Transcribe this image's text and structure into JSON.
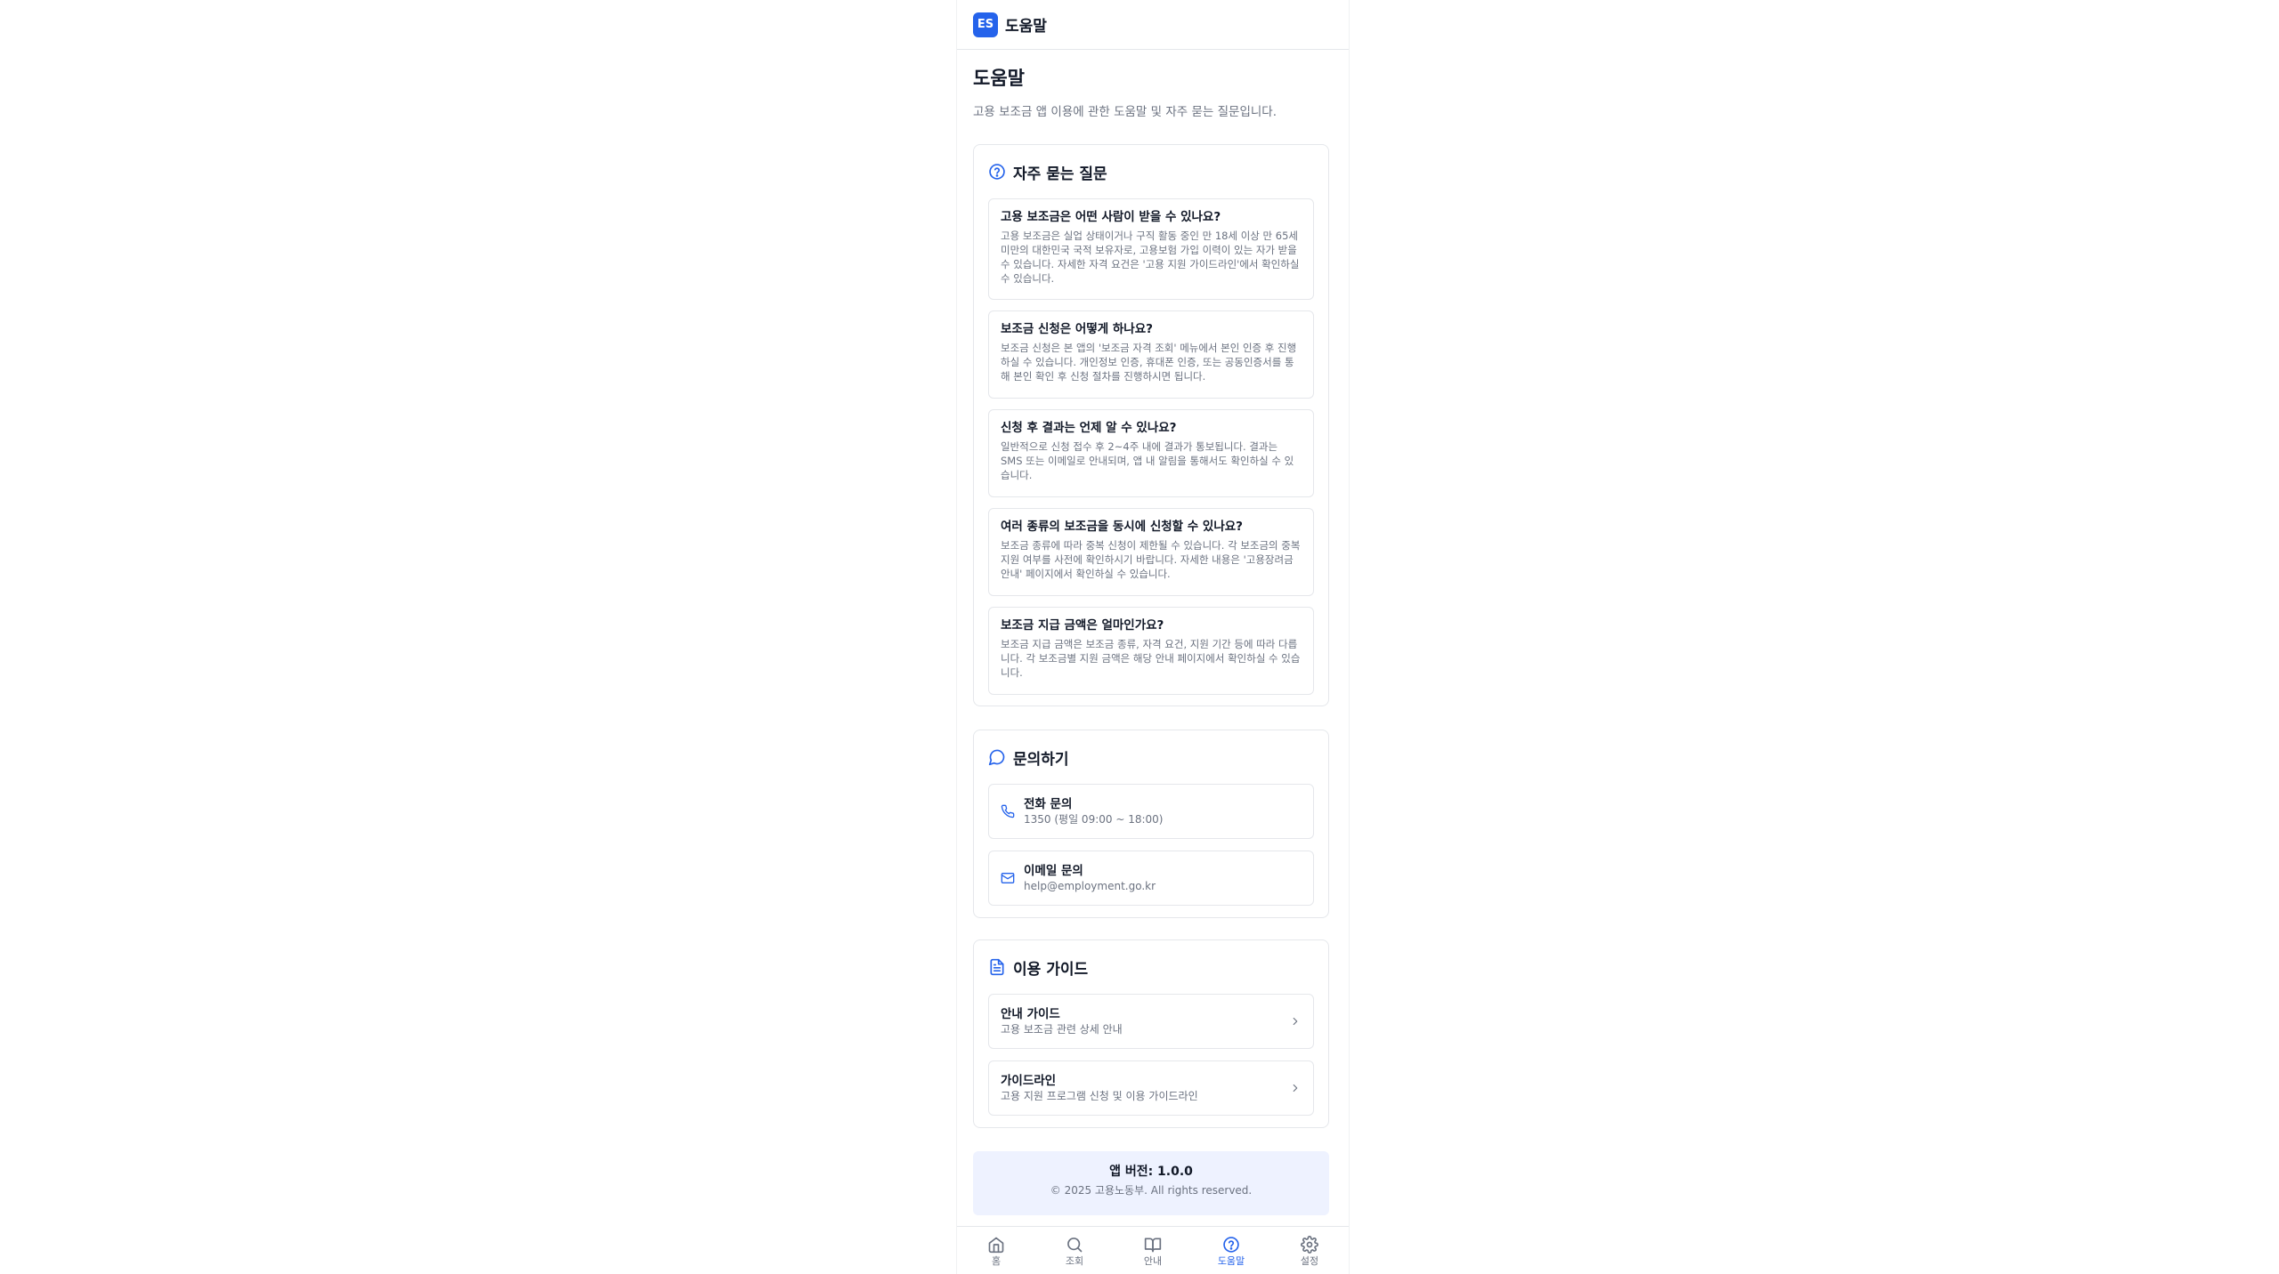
{
  "header": {
    "logo_text": "ES",
    "title": "도움말"
  },
  "page": {
    "title": "도움말",
    "description": "고용 보조금 앱 이용에 관한 도움말 및 자주 묻는 질문입니다."
  },
  "faq": {
    "title": "자주 묻는 질문",
    "icon": "question-circle-icon",
    "items": [
      {
        "q": "고용 보조금은 어떤 사람이 받을 수 있나요?",
        "a": "고용 보조금은 실업 상태이거나 구직 활동 중인 만 18세 이상 만 65세 미만의 대한민국 국적 보유자로, 고용보험 가입 이력이 있는 자가 받을 수 있습니다. 자세한 자격 요건은 '고용 지원 가이드라인'에서 확인하실 수 있습니다."
      },
      {
        "q": "보조금 신청은 어떻게 하나요?",
        "a": "보조금 신청은 본 앱의 '보조금 자격 조회' 메뉴에서 본인 인증 후 진행하실 수 있습니다. 개인정보 인증, 휴대폰 인증, 또는 공동인증서를 통해 본인 확인 후 신청 절차를 진행하시면 됩니다."
      },
      {
        "q": "신청 후 결과는 언제 알 수 있나요?",
        "a": "일반적으로 신청 접수 후 2~4주 내에 결과가 통보됩니다. 결과는 SMS 또는 이메일로 안내되며, 앱 내 알림을 통해서도 확인하실 수 있습니다."
      },
      {
        "q": "여러 종류의 보조금을 동시에 신청할 수 있나요?",
        "a": "보조금 종류에 따라 중복 신청이 제한될 수 있습니다. 각 보조금의 중복 지원 여부를 사전에 확인하시기 바랍니다. 자세한 내용은 '고용장려금 안내' 페이지에서 확인하실 수 있습니다."
      },
      {
        "q": "보조금 지급 금액은 얼마인가요?",
        "a": "보조금 지급 금액은 보조금 종류, 자격 요건, 지원 기간 등에 따라 다릅니다. 각 보조금별 지원 금액은 해당 안내 페이지에서 확인하실 수 있습니다."
      }
    ]
  },
  "contact": {
    "title": "문의하기",
    "icon": "chat-bubble-icon",
    "items": [
      {
        "title": "전화 문의",
        "sub": "1350 (평일 09:00 ~ 18:00)",
        "icon": "phone-icon"
      },
      {
        "title": "이메일 문의",
        "sub": "help@employment.go.kr",
        "icon": "mail-icon"
      }
    ]
  },
  "guide": {
    "title": "이용 가이드",
    "icon": "document-icon",
    "items": [
      {
        "title": "안내 가이드",
        "sub": "고용 보조금 관련 상세 안내",
        "icon": "chevron-right-icon"
      },
      {
        "title": "가이드라인",
        "sub": "고용 지원 프로그램 신청 및 이용 가이드라인",
        "icon": "chevron-right-icon"
      }
    ]
  },
  "footer": {
    "version": "앱 버전: 1.0.0",
    "copyright": "© 2025 고용노동부. All rights reserved."
  },
  "nav": {
    "items": [
      {
        "label": "홈",
        "icon": "home-icon"
      },
      {
        "label": "조회",
        "icon": "search-icon"
      },
      {
        "label": "안내",
        "icon": "book-icon"
      },
      {
        "label": "도움말",
        "icon": "help-icon"
      },
      {
        "label": "설정",
        "icon": "gear-icon"
      }
    ],
    "active": "도움말"
  },
  "colors": {
    "accent": "#2563eb",
    "text": "#111827",
    "muted": "#6b7280",
    "border": "#e5e7eb",
    "version_bg": "#eef2ff"
  }
}
